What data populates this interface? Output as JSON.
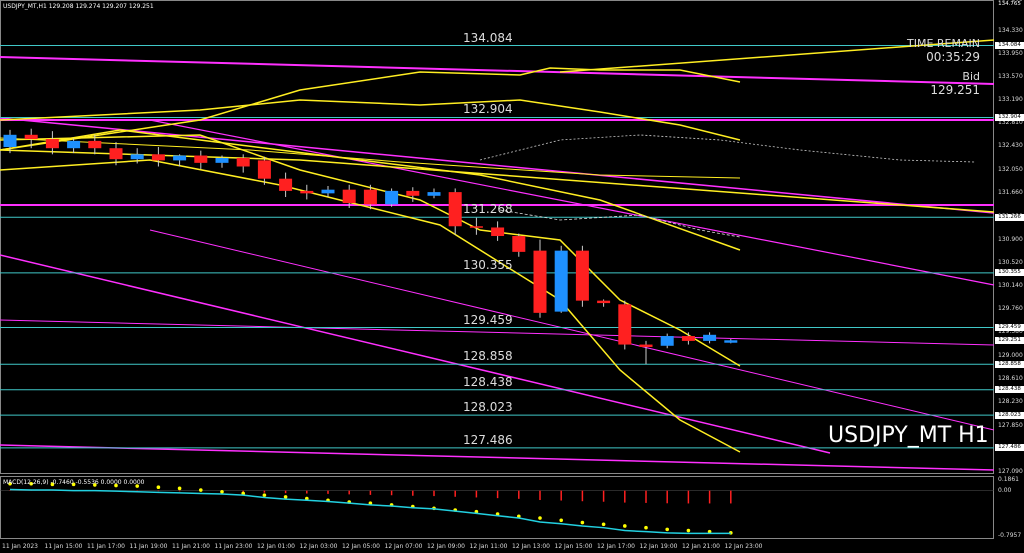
{
  "header": {
    "text": "USDJPY_MT,H1  129.208 129.274 129.207 129.251"
  },
  "symbol_watermark": "USDJPY_MT H1",
  "info": {
    "time_remain_label": "TIME REMAIN",
    "time_remain_value": "00:35:29",
    "bid_label": "Bid",
    "bid_value": "129.251"
  },
  "levels": [
    {
      "label": "134.084",
      "price": 134.084
    },
    {
      "label": "132.904",
      "price": 132.904
    },
    {
      "label": "131.268",
      "price": 131.268
    },
    {
      "label": "130.355",
      "price": 130.355
    },
    {
      "label": "129.459",
      "price": 129.459
    },
    {
      "label": "128.858",
      "price": 128.858
    },
    {
      "label": "128.438",
      "price": 128.438
    },
    {
      "label": "128.023",
      "price": 128.023
    },
    {
      "label": "127.486",
      "price": 127.486
    }
  ],
  "price_axis": {
    "ticks": [
      "134.765",
      "134.330",
      "133.950",
      "133.570",
      "133.190",
      "132.810",
      "132.430",
      "132.050",
      "131.660",
      "131.280",
      "130.900",
      "130.520",
      "130.140",
      "129.760",
      "129.380",
      "129.000",
      "128.610",
      "128.230",
      "127.850",
      "127.470",
      "127.090"
    ],
    "tags": [
      {
        "text": "134.765",
        "color": "#ffffff",
        "bg": "#000000"
      },
      {
        "text": "134.084",
        "color": "#000000",
        "bg": "#ffffff"
      },
      {
        "text": "132.904",
        "color": "#000000",
        "bg": "#ffffff"
      },
      {
        "text": "131.266",
        "color": "#000000",
        "bg": "#ffffff"
      },
      {
        "text": "130.355",
        "color": "#000000",
        "bg": "#ffffff"
      },
      {
        "text": "129.459",
        "color": "#000000",
        "bg": "#ffffff"
      },
      {
        "text": "129.251",
        "color": "#000000",
        "bg": "#ffffff"
      },
      {
        "text": "128.858",
        "color": "#000000",
        "bg": "#ffffff"
      },
      {
        "text": "128.438",
        "color": "#000000",
        "bg": "#ffffff"
      },
      {
        "text": "128.023",
        "color": "#000000",
        "bg": "#ffffff"
      },
      {
        "text": "127.486",
        "color": "#000000",
        "bg": "#ffffff"
      }
    ]
  },
  "macd": {
    "label": "MACD(12,26,9) -0.7460 -0.5536 0.0000 0.0000",
    "ticks": [
      "0.1861",
      "0.00",
      "-0.7957"
    ]
  },
  "time_axis": [
    "11 Jan 2023",
    "11 Jan 15:00",
    "11 Jan 17:00",
    "11 Jan 19:00",
    "11 Jan 21:00",
    "11 Jan 23:00",
    "12 Jan 01:00",
    "12 Jan 03:00",
    "12 Jan 05:00",
    "12 Jan 07:00",
    "12 Jan 09:00",
    "12 Jan 11:00",
    "12 Jan 13:00",
    "12 Jan 15:00",
    "12 Jan 17:00",
    "12 Jan 19:00",
    "12 Jan 21:00",
    "12 Jan 23:00"
  ],
  "colors": {
    "background": "#000000",
    "bull": "#1e90ff",
    "bear": "#ff2020",
    "level_line": "#40c8c8",
    "magenta": "#ff30ff",
    "yellow": "#ffee22",
    "macd_signal": "#ffff00",
    "macd_line": "#22d0e0"
  },
  "chart_data": {
    "type": "candlestick",
    "ylim": [
      127.09,
      134.765
    ],
    "candles": [
      {
        "o": 132.42,
        "h": 132.7,
        "c": 132.62,
        "l": 132.32
      },
      {
        "o": 132.62,
        "h": 132.72,
        "c": 132.55,
        "l": 132.4
      },
      {
        "o": 132.55,
        "h": 132.68,
        "c": 132.4,
        "l": 132.3
      },
      {
        "o": 132.4,
        "h": 132.56,
        "c": 132.52,
        "l": 132.32
      },
      {
        "o": 132.52,
        "h": 132.62,
        "c": 132.4,
        "l": 132.3
      },
      {
        "o": 132.4,
        "h": 132.5,
        "c": 132.22,
        "l": 132.12
      },
      {
        "o": 132.22,
        "h": 132.4,
        "c": 132.3,
        "l": 132.15
      },
      {
        "o": 132.3,
        "h": 132.42,
        "c": 132.2,
        "l": 132.1
      },
      {
        "o": 132.2,
        "h": 132.3,
        "c": 132.28,
        "l": 132.1
      },
      {
        "o": 132.28,
        "h": 132.36,
        "c": 132.16,
        "l": 132.06
      },
      {
        "o": 132.16,
        "h": 132.28,
        "c": 132.24,
        "l": 132.08
      },
      {
        "o": 132.24,
        "h": 132.3,
        "c": 132.1,
        "l": 132.0
      },
      {
        "o": 132.2,
        "h": 132.26,
        "c": 131.9,
        "l": 131.8
      },
      {
        "o": 131.9,
        "h": 132.0,
        "c": 131.7,
        "l": 131.6
      },
      {
        "o": 131.7,
        "h": 131.8,
        "c": 131.66,
        "l": 131.56
      },
      {
        "o": 131.66,
        "h": 131.78,
        "c": 131.72,
        "l": 131.6
      },
      {
        "o": 131.72,
        "h": 131.8,
        "c": 131.5,
        "l": 131.42
      },
      {
        "o": 131.72,
        "h": 131.8,
        "c": 131.48,
        "l": 131.4
      },
      {
        "o": 131.48,
        "h": 131.74,
        "c": 131.7,
        "l": 131.44
      },
      {
        "o": 131.7,
        "h": 131.76,
        "c": 131.62,
        "l": 131.52
      },
      {
        "o": 131.62,
        "h": 131.74,
        "c": 131.68,
        "l": 131.58
      },
      {
        "o": 131.68,
        "h": 131.74,
        "c": 131.12,
        "l": 130.98
      },
      {
        "o": 131.12,
        "h": 131.26,
        "c": 131.1,
        "l": 130.98
      },
      {
        "o": 131.1,
        "h": 131.2,
        "c": 130.96,
        "l": 130.88
      },
      {
        "o": 130.96,
        "h": 131.0,
        "c": 130.7,
        "l": 130.62
      },
      {
        "o": 130.72,
        "h": 130.9,
        "c": 129.7,
        "l": 129.62
      },
      {
        "o": 129.72,
        "h": 130.8,
        "c": 130.72,
        "l": 129.7
      },
      {
        "o": 130.72,
        "h": 130.8,
        "c": 129.9,
        "l": 129.8
      },
      {
        "o": 129.9,
        "h": 129.92,
        "c": 129.86,
        "l": 129.8
      },
      {
        "o": 129.84,
        "h": 129.9,
        "c": 129.18,
        "l": 129.1
      },
      {
        "o": 129.18,
        "h": 129.24,
        "c": 129.14,
        "l": 128.86
      },
      {
        "o": 129.16,
        "h": 129.36,
        "c": 129.32,
        "l": 129.12
      },
      {
        "o": 129.32,
        "h": 129.38,
        "c": 129.24,
        "l": 129.18
      },
      {
        "o": 129.24,
        "h": 129.38,
        "c": 129.34,
        "l": 129.2
      },
      {
        "o": 129.21,
        "h": 129.27,
        "c": 129.25,
        "l": 129.2
      }
    ],
    "macd_histogram": [
      0.02,
      0.01,
      0.01,
      0.0,
      0.0,
      -0.01,
      -0.02,
      -0.03,
      -0.04,
      -0.05,
      -0.06,
      -0.08,
      -0.12,
      -0.15,
      -0.17,
      -0.19,
      -0.22,
      -0.25,
      -0.27,
      -0.3,
      -0.32,
      -0.36,
      -0.4,
      -0.44,
      -0.48,
      -0.55,
      -0.58,
      -0.62,
      -0.65,
      -0.7,
      -0.72,
      -0.74,
      -0.75,
      -0.75,
      -0.75
    ],
    "macd_signal": [
      0.12,
      0.12,
      0.11,
      0.11,
      0.1,
      0.09,
      0.08,
      0.06,
      0.04,
      0.01,
      -0.02,
      -0.05,
      -0.08,
      -0.11,
      -0.14,
      -0.17,
      -0.2,
      -0.22,
      -0.25,
      -0.28,
      -0.31,
      -0.34,
      -0.37,
      -0.41,
      -0.45,
      -0.48,
      -0.52,
      -0.56,
      -0.59,
      -0.62,
      -0.65,
      -0.68,
      -0.7,
      -0.72,
      -0.74
    ]
  }
}
